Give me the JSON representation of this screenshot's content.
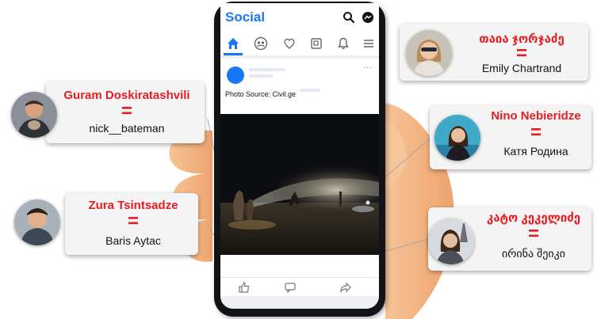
{
  "app": {
    "title": "Social",
    "icons": {
      "search": "search-icon",
      "messenger": "messenger-icon",
      "home": "home-icon",
      "friends": "friends-icon",
      "heart": "heart-icon",
      "pages": "pages-icon",
      "notifications": "bell-icon",
      "menu": "menu-icon",
      "like": "thumbs-up-icon",
      "comment": "comment-icon",
      "share": "share-icon"
    },
    "post": {
      "photo_source": "Photo Source: Civil.ge",
      "more": "..."
    },
    "colors": {
      "brand": "#1877f2",
      "label_red": "#e61e24",
      "hand": "#f2b27e",
      "phone": "#121317"
    }
  },
  "matches": [
    {
      "id": "guram",
      "georgian_name": "Guram Doskiratashvili",
      "equals": "=",
      "alias": "nick__bateman"
    },
    {
      "id": "zura",
      "georgian_name": "Zura Tsintsadze",
      "equals": "=",
      "alias": "Baris Aytac"
    },
    {
      "id": "taia",
      "georgian_name": "თაია ჯორჯაძე",
      "equals": "=",
      "alias": "Emily Chartrand"
    },
    {
      "id": "nino",
      "georgian_name": "Nino Nebieridze",
      "equals": "=",
      "alias": "Катя Родина"
    },
    {
      "id": "keto",
      "georgian_name": "კატო კეკელიძე",
      "equals": "=",
      "alias": "ირინა შეიკი"
    }
  ]
}
